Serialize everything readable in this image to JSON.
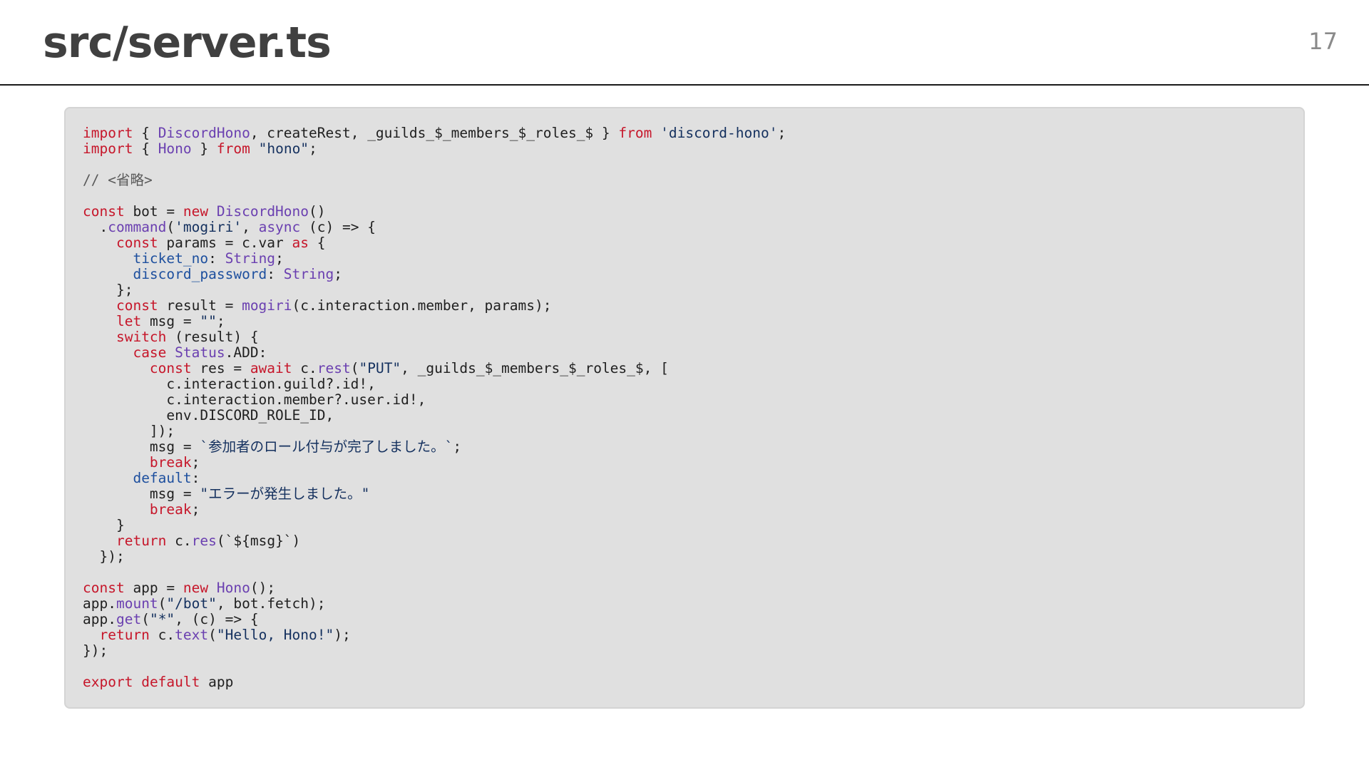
{
  "slide": {
    "title": "src/server.ts",
    "page_number": "17"
  },
  "colors": {
    "keyword": "#c6162a",
    "function": "#6a3fb0",
    "string": "#14305e",
    "property": "#1d4f9e",
    "comment": "#5a5a5a",
    "plain": "#1f1f1f",
    "code_background": "#e0e0e0"
  },
  "code": {
    "language": "typescript",
    "lines": [
      [
        [
          "kw",
          "import"
        ],
        [
          "pl",
          " { "
        ],
        [
          "fn",
          "DiscordHono"
        ],
        [
          "pl",
          ", createRest, _guilds_$_members_$_roles_$ } "
        ],
        [
          "kw",
          "from"
        ],
        [
          "pl",
          " "
        ],
        [
          "str",
          "'discord-hono'"
        ],
        [
          "pl",
          ";"
        ]
      ],
      [
        [
          "kw",
          "import"
        ],
        [
          "pl",
          " { "
        ],
        [
          "fn",
          "Hono"
        ],
        [
          "pl",
          " } "
        ],
        [
          "kw",
          "from"
        ],
        [
          "pl",
          " "
        ],
        [
          "str",
          "\"hono\""
        ],
        [
          "pl",
          ";"
        ]
      ],
      [],
      [
        [
          "cm",
          "// <省略>"
        ]
      ],
      [],
      [
        [
          "kw",
          "const"
        ],
        [
          "pl",
          " bot = "
        ],
        [
          "kw",
          "new"
        ],
        [
          "pl",
          " "
        ],
        [
          "fn",
          "DiscordHono"
        ],
        [
          "pl",
          "()"
        ]
      ],
      [
        [
          "pl",
          "  ."
        ],
        [
          "fn",
          "command"
        ],
        [
          "pl",
          "("
        ],
        [
          "str",
          "'mogiri'"
        ],
        [
          "pl",
          ", "
        ],
        [
          "fn",
          "async"
        ],
        [
          "pl",
          " (c) => {"
        ]
      ],
      [
        [
          "pl",
          "    "
        ],
        [
          "kw",
          "const"
        ],
        [
          "pl",
          " params = c.var "
        ],
        [
          "kw",
          "as"
        ],
        [
          "pl",
          " {"
        ]
      ],
      [
        [
          "pl",
          "      "
        ],
        [
          "prop",
          "ticket_no"
        ],
        [
          "pl",
          ": "
        ],
        [
          "fn",
          "String"
        ],
        [
          "pl",
          ";"
        ]
      ],
      [
        [
          "pl",
          "      "
        ],
        [
          "prop",
          "discord_password"
        ],
        [
          "pl",
          ": "
        ],
        [
          "fn",
          "String"
        ],
        [
          "pl",
          ";"
        ]
      ],
      [
        [
          "pl",
          "    };"
        ]
      ],
      [
        [
          "pl",
          "    "
        ],
        [
          "kw",
          "const"
        ],
        [
          "pl",
          " result = "
        ],
        [
          "fn",
          "mogiri"
        ],
        [
          "pl",
          "(c.interaction.member, params);"
        ]
      ],
      [
        [
          "pl",
          "    "
        ],
        [
          "kw",
          "let"
        ],
        [
          "pl",
          " msg = "
        ],
        [
          "str",
          "\"\""
        ],
        [
          "pl",
          ";"
        ]
      ],
      [
        [
          "pl",
          "    "
        ],
        [
          "kw",
          "switch"
        ],
        [
          "pl",
          " (result) {"
        ]
      ],
      [
        [
          "pl",
          "      "
        ],
        [
          "kw",
          "case"
        ],
        [
          "pl",
          " "
        ],
        [
          "fn",
          "Status"
        ],
        [
          "pl",
          ".ADD:"
        ]
      ],
      [
        [
          "pl",
          "        "
        ],
        [
          "kw",
          "const"
        ],
        [
          "pl",
          " res = "
        ],
        [
          "kw",
          "await"
        ],
        [
          "pl",
          " c."
        ],
        [
          "fn",
          "rest"
        ],
        [
          "pl",
          "("
        ],
        [
          "str",
          "\"PUT\""
        ],
        [
          "pl",
          ", _guilds_$_members_$_roles_$, ["
        ]
      ],
      [
        [
          "pl",
          "          c.interaction.guild?.id!,"
        ]
      ],
      [
        [
          "pl",
          "          c.interaction.member?.user.id!,"
        ]
      ],
      [
        [
          "pl",
          "          env.DISCORD_ROLE_ID,"
        ]
      ],
      [
        [
          "pl",
          "        ]);"
        ]
      ],
      [
        [
          "pl",
          "        msg = "
        ],
        [
          "str",
          "`参加者のロール付与が完了しました。`"
        ],
        [
          "pl",
          ";"
        ]
      ],
      [
        [
          "pl",
          "        "
        ],
        [
          "kw",
          "break"
        ],
        [
          "pl",
          ";"
        ]
      ],
      [
        [
          "pl",
          "      "
        ],
        [
          "prop",
          "default"
        ],
        [
          "pl",
          ":"
        ]
      ],
      [
        [
          "pl",
          "        msg = "
        ],
        [
          "str",
          "\"エラーが発生しました。\""
        ]
      ],
      [
        [
          "pl",
          "        "
        ],
        [
          "kw",
          "break"
        ],
        [
          "pl",
          ";"
        ]
      ],
      [
        [
          "pl",
          "    }"
        ]
      ],
      [
        [
          "pl",
          "    "
        ],
        [
          "kw",
          "return"
        ],
        [
          "pl",
          " c."
        ],
        [
          "fn",
          "res"
        ],
        [
          "pl",
          "(`${msg}`)"
        ]
      ],
      [
        [
          "pl",
          "  });"
        ]
      ],
      [],
      [
        [
          "kw",
          "const"
        ],
        [
          "pl",
          " app = "
        ],
        [
          "kw",
          "new"
        ],
        [
          "pl",
          " "
        ],
        [
          "fn",
          "Hono"
        ],
        [
          "pl",
          "();"
        ]
      ],
      [
        [
          "pl",
          "app."
        ],
        [
          "fn",
          "mount"
        ],
        [
          "pl",
          "("
        ],
        [
          "str",
          "\"/bot\""
        ],
        [
          "pl",
          ", bot.fetch);"
        ]
      ],
      [
        [
          "pl",
          "app."
        ],
        [
          "fn",
          "get"
        ],
        [
          "pl",
          "("
        ],
        [
          "str",
          "\"*\""
        ],
        [
          "pl",
          ", (c) => {"
        ]
      ],
      [
        [
          "pl",
          "  "
        ],
        [
          "kw",
          "return"
        ],
        [
          "pl",
          " c."
        ],
        [
          "fn",
          "text"
        ],
        [
          "pl",
          "("
        ],
        [
          "str",
          "\"Hello, Hono!\""
        ],
        [
          "pl",
          ");"
        ]
      ],
      [
        [
          "pl",
          "});"
        ]
      ],
      [],
      [
        [
          "kw",
          "export"
        ],
        [
          "pl",
          " "
        ],
        [
          "kw",
          "default"
        ],
        [
          "pl",
          " app"
        ]
      ]
    ]
  }
}
